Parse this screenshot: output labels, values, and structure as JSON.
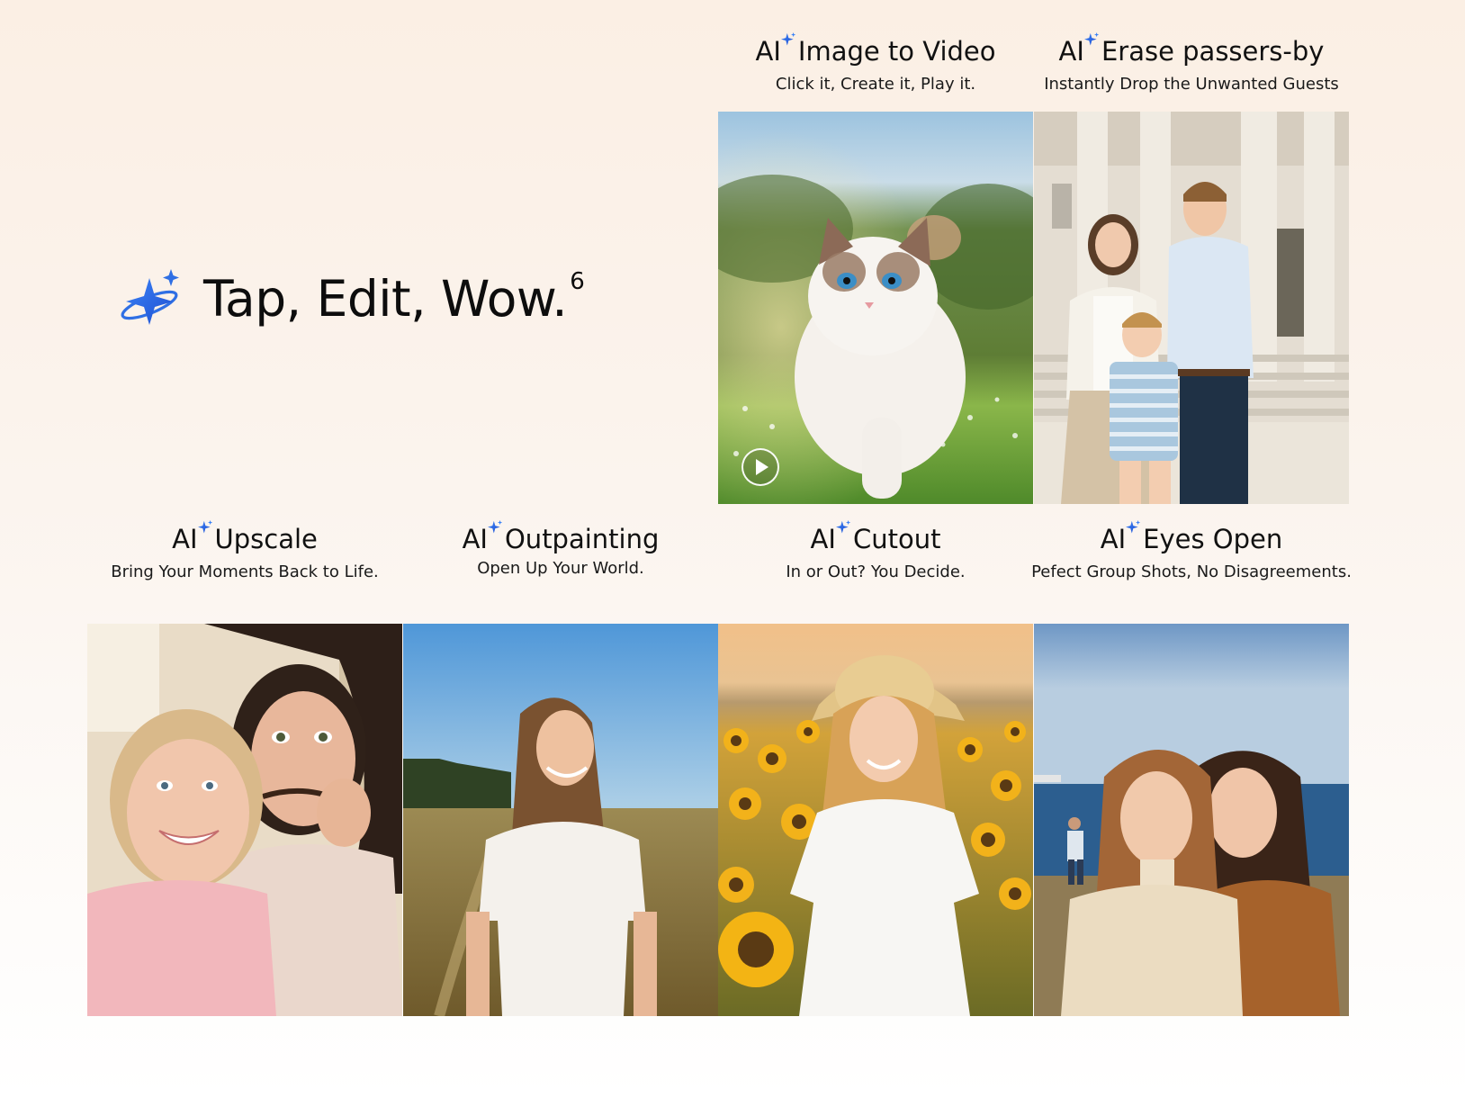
{
  "hero": {
    "title": "Tap, Edit, Wow.",
    "superscript": "6",
    "icon": "ai-sparkle-icon"
  },
  "accent_color": "#2f6fe4",
  "features": [
    {
      "ai_label": "AI",
      "title": "Image to Video",
      "subtitle": "Click it, Create it, Play it.",
      "image": "white-ragdoll-cat-walking-in-meadow",
      "has_play_button": true
    },
    {
      "ai_label": "AI",
      "title": "Erase passers-by",
      "subtitle": "Instantly Drop the Unwanted Guests",
      "image": "family-in-front-of-classical-building"
    },
    {
      "ai_label": "AI",
      "title": "Upscale",
      "subtitle": "Bring Your Moments Back to Life.",
      "image": "mother-and-daughter-selfie"
    },
    {
      "ai_label": "AI",
      "title": "Outpainting",
      "subtitle": "Open Up Your World.",
      "image": "young-woman-in-field-at-sunset"
    },
    {
      "ai_label": "AI",
      "title": "Cutout",
      "subtitle": "In or Out? You Decide.",
      "image": "girl-in-straw-hat-in-sunflower-field"
    },
    {
      "ai_label": "AI",
      "title": "Eyes Open",
      "subtitle": "Pefect Group Shots, No Disagreements.",
      "image": "two-women-at-seaside"
    }
  ]
}
